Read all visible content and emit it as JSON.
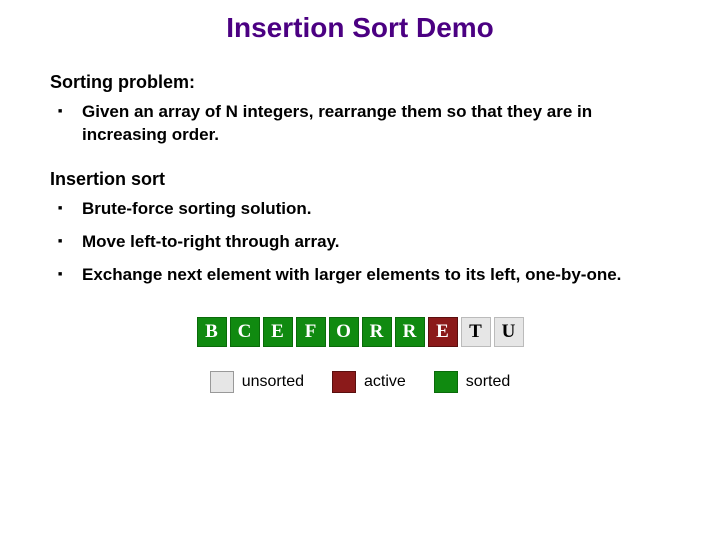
{
  "title": "Insertion Sort Demo",
  "section1": {
    "heading": "Sorting problem:",
    "bullets": [
      "Given an array of N integers, rearrange them so that they are in increasing order."
    ]
  },
  "section2": {
    "heading": "Insertion sort",
    "bullets": [
      "Brute-force sorting solution.",
      "Move left-to-right through array.",
      "Exchange next element with larger elements to its left, one-by-one."
    ]
  },
  "array": [
    {
      "letter": "B",
      "state": "sorted"
    },
    {
      "letter": "C",
      "state": "sorted"
    },
    {
      "letter": "E",
      "state": "sorted"
    },
    {
      "letter": "F",
      "state": "sorted"
    },
    {
      "letter": "O",
      "state": "sorted"
    },
    {
      "letter": "R",
      "state": "sorted"
    },
    {
      "letter": "R",
      "state": "sorted"
    },
    {
      "letter": "E",
      "state": "active"
    },
    {
      "letter": "T",
      "state": "unsorted"
    },
    {
      "letter": "U",
      "state": "unsorted"
    }
  ],
  "legend": {
    "unsorted": "unsorted",
    "active": "active",
    "sorted": "sorted"
  },
  "colors": {
    "sorted": "#108a10",
    "active": "#8b1a1a",
    "unsorted": "#e6e6e6",
    "title": "#4b0082"
  }
}
